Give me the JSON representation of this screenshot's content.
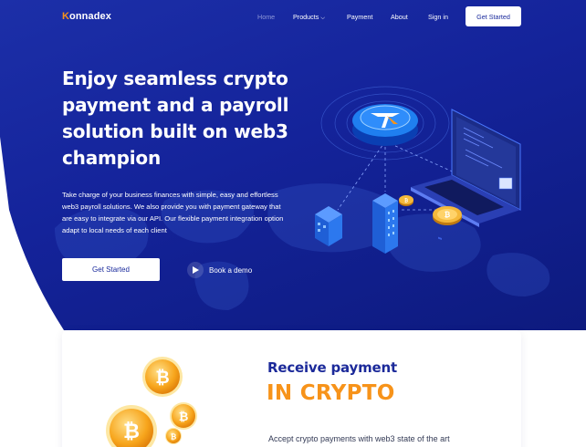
{
  "brand": {
    "name_initial": "K",
    "name_rest": "onnadex"
  },
  "nav": {
    "home": "Home",
    "products": "Products",
    "payment": "Payment",
    "about": "About",
    "signin": "Sign in",
    "get_started": "Get Started"
  },
  "hero": {
    "headline": [
      "Enjoy seamless crypto",
      "payment and a payroll",
      "solution built on web3",
      "champion"
    ],
    "description": "Take charge of your business finances with simple, easy and effortless web3 payroll solutions. We also provide you with payment gateway that are easy to integrate via our API. Our flexible payment integration option adapt to local needs of each client",
    "cta": "Get Started",
    "demo": "Book a demo"
  },
  "section": {
    "title": "Receive payment",
    "highlight": "IN CRYPTO",
    "text": "Accept crypto payments with web3 state of the art"
  },
  "colors": {
    "hero_bg": "#14239a",
    "brand_orange": "#f7931a",
    "heading_blue": "#1c2a9a"
  },
  "icons": {
    "play": "play-icon",
    "chevron": "chevron-down-icon",
    "bitcoin": "bitcoin-icon"
  }
}
